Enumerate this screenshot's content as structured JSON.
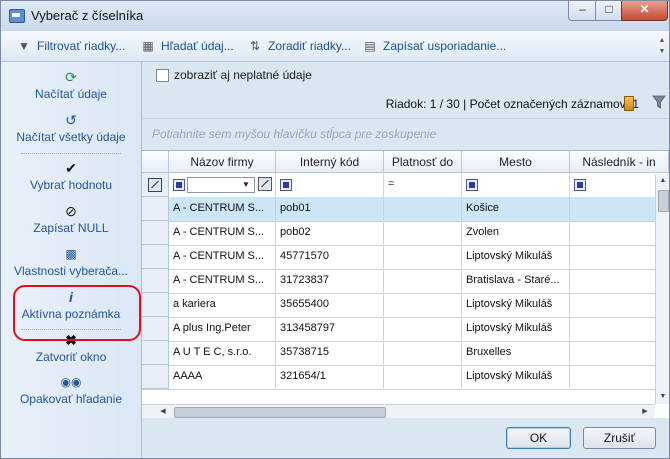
{
  "window": {
    "title": "Vyberač z číselníka",
    "minimize_icon": "minimize-icon",
    "maximize_icon": "maximize-icon",
    "close_icon": "close-icon"
  },
  "toolbar": {
    "items": [
      {
        "label": "Filtrovať riadky...",
        "icon": "filter-icon"
      },
      {
        "label": "Hľadať údaj...",
        "icon": "grid-search-icon"
      },
      {
        "label": "Zoradiť riadky...",
        "icon": "sort-icon"
      },
      {
        "label": "Zapísať usporiadanie...",
        "icon": "save-layout-icon"
      }
    ]
  },
  "sidebar": {
    "items": [
      {
        "label": "Načítať údaje",
        "icon": "refresh-icon"
      },
      {
        "label": "Načítať všetky údaje",
        "icon": "reload-all-icon"
      },
      {
        "label": "Vybrať hodnotu",
        "icon": "checkmark-icon"
      },
      {
        "label": "Zapísať NULL",
        "icon": "null-icon"
      },
      {
        "label": "Vlastnosti vyberača...",
        "icon": "properties-icon"
      },
      {
        "label": "Aktívna poznámka",
        "icon": "info-icon"
      },
      {
        "label": "Zatvoriť okno",
        "icon": "close-x-icon"
      },
      {
        "label": "Opakovať hľadanie",
        "icon": "binoculars-icon"
      }
    ],
    "highlight_color": "#e0101a"
  },
  "options": {
    "show_invalid_label": "zobraziť aj neplatné údaje",
    "show_invalid_checked": false
  },
  "status": {
    "row_info": "Riadok: 1 / 30 | Počet označených záznamov: 1"
  },
  "grouping_hint": "Potiahnite sem myšou hlavičku stĺpca pre zoskupenie",
  "table": {
    "columns": [
      "Názov firmy",
      "Interný kód",
      "Platnosť do",
      "Mesto",
      "Následník - in"
    ],
    "filter_equals": "=",
    "rows": [
      [
        "A - CENTRUM S...",
        "pob01",
        "",
        "Košice",
        ""
      ],
      [
        "A - CENTRUM S...",
        "pob02",
        "",
        "Zvolen",
        ""
      ],
      [
        "A - CENTRUM S...",
        "45771570",
        "",
        "Liptovský Mikuláš",
        ""
      ],
      [
        "A - CENTRUM S...",
        "31723837",
        "",
        "Bratislava - Staré...",
        ""
      ],
      [
        "a kariera",
        "35655400",
        "",
        "Liptovský Mikuláš",
        ""
      ],
      [
        "A plus Ing.Peter",
        "313458797",
        "",
        "Liptovský Mikuláš",
        ""
      ],
      [
        "A U T E C, s.r.o.",
        "35738715",
        "",
        "Bruxelles",
        ""
      ],
      [
        "AAAA",
        "321654/1",
        "",
        "Liptovský Mikuláš",
        ""
      ]
    ],
    "selected_row": 0
  },
  "buttons": {
    "ok": "OK",
    "cancel": "Zrušiť"
  }
}
